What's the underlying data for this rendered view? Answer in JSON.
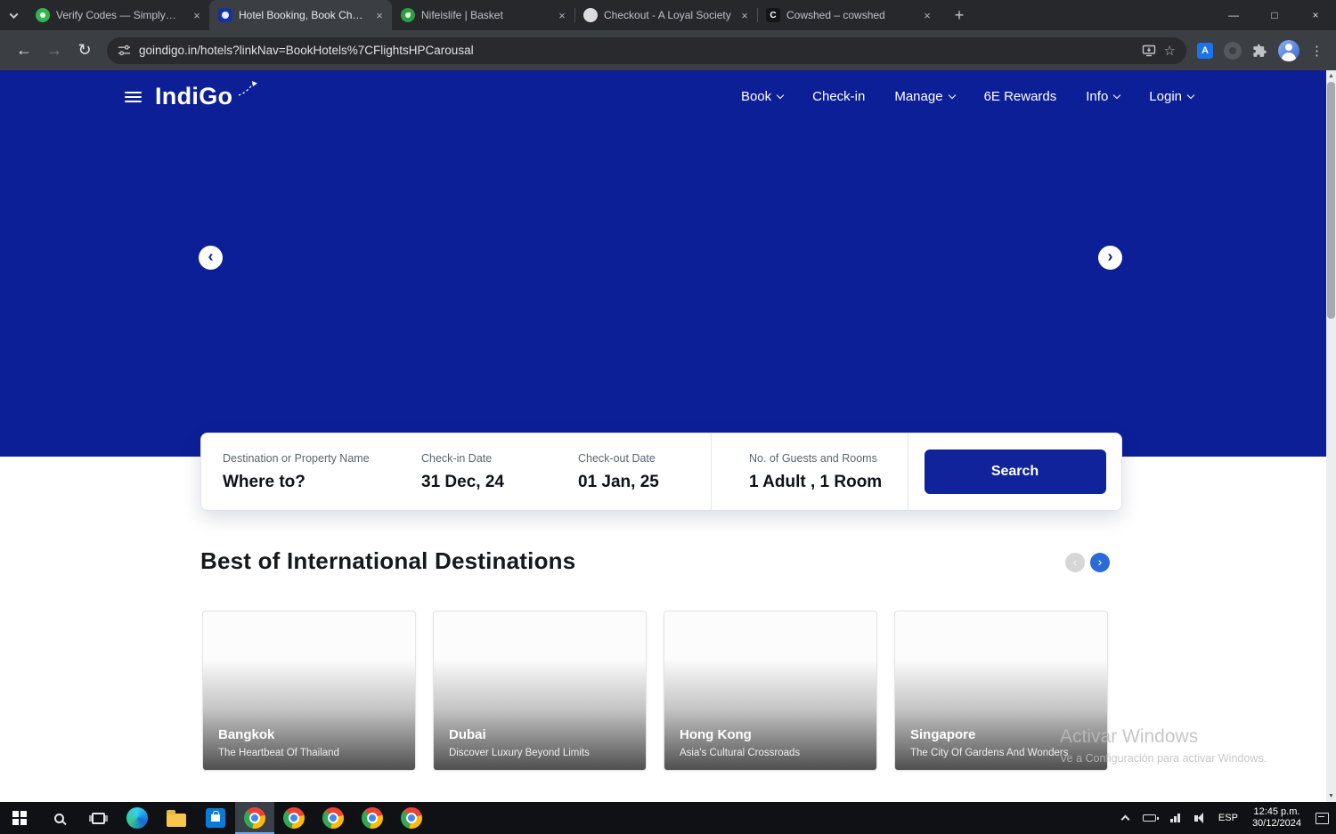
{
  "browser": {
    "tabs": [
      {
        "title": "Verify Codes — SimplyCodes"
      },
      {
        "title": "Hotel Booking, Book Cheap, Bu"
      },
      {
        "title": "Nifeislife | Basket"
      },
      {
        "title": "Checkout - A Loyal Society"
      },
      {
        "title": "Cowshed – cowshed",
        "favicon_text": "C"
      }
    ],
    "url": "goindigo.in/hotels?linkNav=BookHotels%7CFlightsHPCarousal"
  },
  "site": {
    "logo_text": "IndiGo",
    "nav": [
      {
        "label": "Book"
      },
      {
        "label": "Check-in"
      },
      {
        "label": "Manage"
      },
      {
        "label": "6E Rewards"
      },
      {
        "label": "Info"
      },
      {
        "label": "Login"
      }
    ],
    "search": {
      "destination_label": "Destination or Property Name",
      "destination_value": "Where to?",
      "checkin_label": "Check-in Date",
      "checkin_value": "31 Dec, 24",
      "checkout_label": "Check-out Date",
      "checkout_value": "01 Jan, 25",
      "guests_label": "No. of Guests and Rooms",
      "guests_value": "1 Adult , 1 Room",
      "button_label": "Search"
    },
    "section_title": "Best of International Destinations",
    "destinations": [
      {
        "name": "Bangkok",
        "tagline": "The Heartbeat Of Thailand"
      },
      {
        "name": "Dubai",
        "tagline": "Discover Luxury Beyond Limits"
      },
      {
        "name": "Hong Kong",
        "tagline": "Asia's Cultural Crossroads"
      },
      {
        "name": "Singapore",
        "tagline": "The City Of Gardens And Wonders"
      }
    ]
  },
  "watermark": {
    "line1": "Activar Windows",
    "line2": "Ve a Configuración para activar Windows."
  },
  "taskbar": {
    "language": "ESP",
    "time": "12:45 p.m.",
    "date": "30/12/2024"
  },
  "glyphs": {
    "close_tab": "×",
    "new_tab": "+",
    "minimize": "—",
    "maximize": "□",
    "close_window": "×",
    "back": "←",
    "forward": "→",
    "reload": "↻",
    "bookmark_star": "☆",
    "menu_kebab": "⋮",
    "carousel_prev": "‹",
    "carousel_next": "›",
    "scroll_up": "▲",
    "scroll_down": "▼"
  },
  "colors": {
    "brand_blue": "#0d1f96",
    "accent_blue": "#2b6bd8",
    "search_button_blue": "#10239a"
  }
}
